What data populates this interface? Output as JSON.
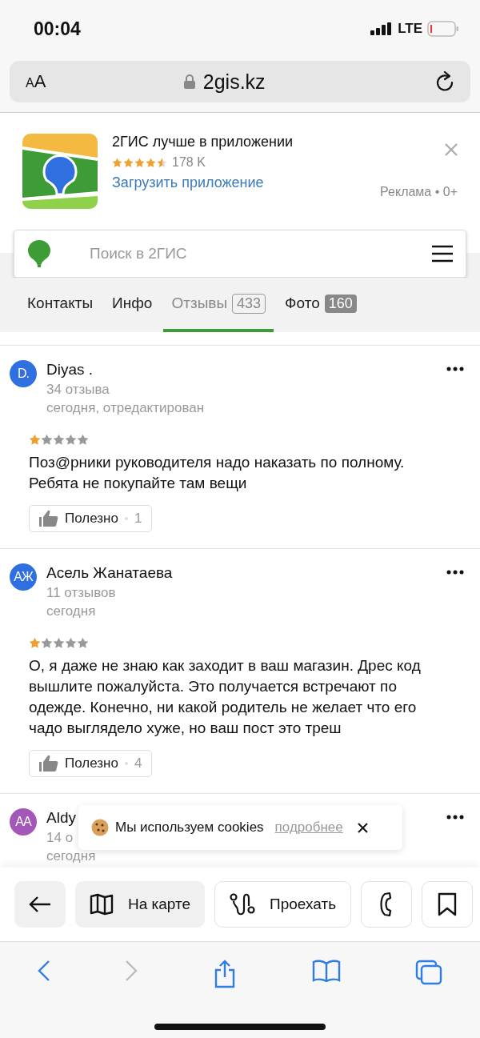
{
  "status_bar": {
    "time": "00:04",
    "network": "LTE"
  },
  "browser": {
    "text_size": "AA",
    "url": "2gis.kz"
  },
  "ad": {
    "title": "2ГИС лучше в приложении",
    "stars": 4.5,
    "rating_count": "178 K",
    "link": "Загрузить приложение",
    "label": "Реклама • 0+"
  },
  "search": {
    "placeholder": "Поиск в 2ГИС"
  },
  "tabs": [
    {
      "label": "Контакты",
      "selected": false
    },
    {
      "label": "Инфо",
      "selected": false
    },
    {
      "label": "Отзывы",
      "count": "433",
      "selected": true
    },
    {
      "label": "Фото",
      "count": "160",
      "selected": false
    }
  ],
  "reviews": [
    {
      "initials": "D.",
      "color": "#2f6fe0",
      "name": "Diyas .",
      "review_count": "34 отзыва",
      "date": "сегодня, отредактирован",
      "stars": 1,
      "text": "Поз@рники руководителя надо наказать по полному. Ребята не покупайте там вещи",
      "helpful_label": "Полезно",
      "helpful_count": "1"
    },
    {
      "initials": "АЖ",
      "color": "#2f6fe0",
      "name": "Асель Жанатаева",
      "review_count": "11 отзывов",
      "date": "сегодня",
      "stars": 1,
      "text": "О, я даже не знаю как заходит в ваш магазин. Дрес код вышлите пожалуйста. Это получается встречают по одежде. Конечно, ни какой родитель не желает что его чадо выглядело хуже, но ваш пост это треш",
      "helpful_label": "Полезно",
      "helpful_count": "4"
    },
    {
      "initials": "AA",
      "color": "#a357b8",
      "name": "Aldy",
      "review_count": "14 о",
      "date": "сегодня"
    }
  ],
  "cookie_banner": {
    "text": "Мы используем cookies",
    "link": "подробнее"
  },
  "actions": {
    "map": "На карте",
    "route": "Проехать"
  }
}
